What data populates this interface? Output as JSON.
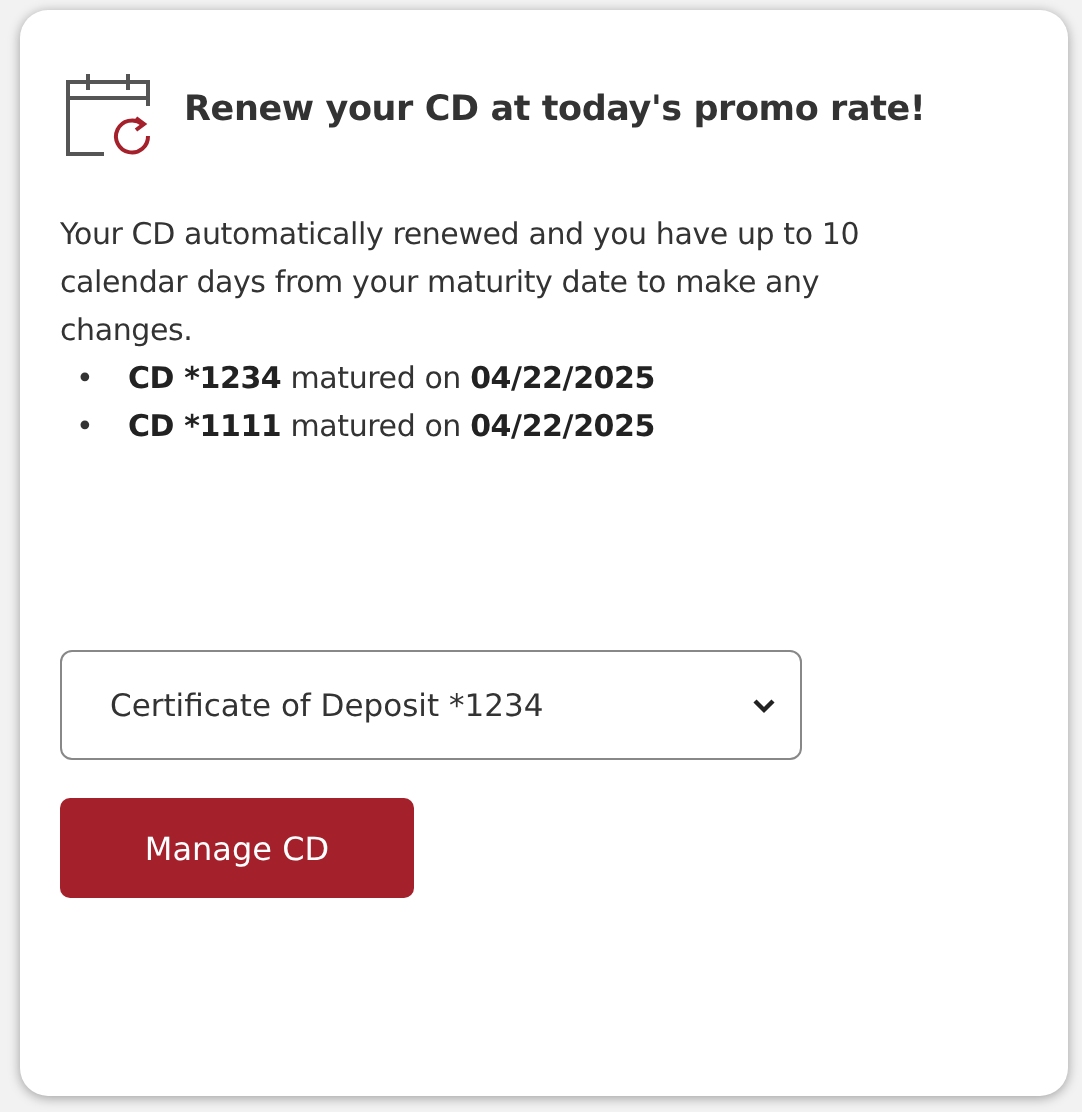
{
  "card": {
    "title": "Renew your CD at today's promo rate!",
    "message": "Your CD automatically renewed and you have up to 10 calendar days from your maturity date to make any changes.",
    "matured": [
      {
        "bullet": "•",
        "account": "CD *1234",
        "text": "matured on",
        "date": "04/22/2025"
      },
      {
        "bullet": "•",
        "account": "CD *1111",
        "text": "matured on",
        "date": "04/22/2025"
      }
    ],
    "dropdown": {
      "value": "Certificate of Deposit *1234"
    },
    "button": "Manage CD"
  }
}
